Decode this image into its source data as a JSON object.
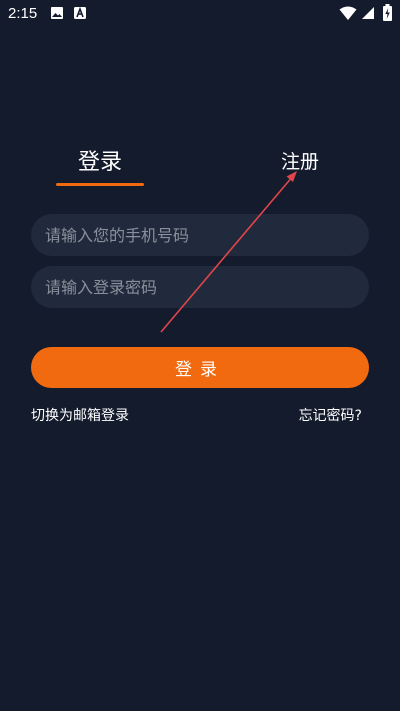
{
  "status_bar": {
    "time": "2:15",
    "left_icons": [
      "image-icon",
      "a-app-icon"
    ],
    "right_icons": [
      "wifi-icon",
      "signal-icon",
      "battery-charging-icon"
    ]
  },
  "tabs": {
    "login": "登录",
    "register": "注册",
    "active": "login"
  },
  "form": {
    "phone_placeholder": "请输入您的手机号码",
    "phone_value": "",
    "password_placeholder": "请输入登录密码",
    "password_value": ""
  },
  "login_button": {
    "label": "登录"
  },
  "links": {
    "switch_email": "切换为邮箱登录",
    "forgot_password": "忘记密码?"
  },
  "colors": {
    "background": "#141b2d",
    "accent": "#f26a10",
    "field_bg": "#212a3c",
    "placeholder": "#8a909b",
    "annotation_arrow": "#e0454a"
  }
}
